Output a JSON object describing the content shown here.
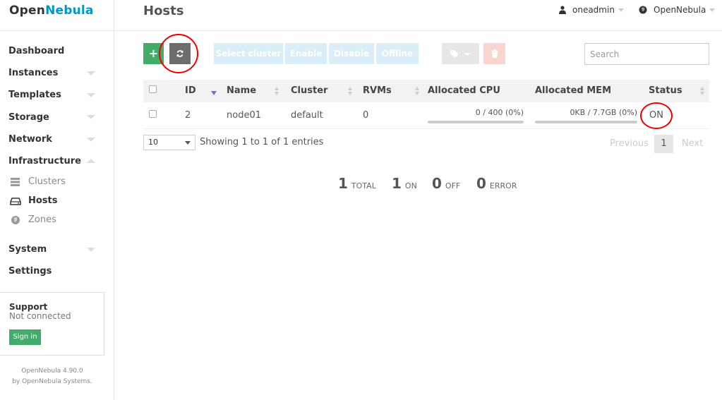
{
  "sidebar": {
    "logo_part1": "Open",
    "logo_part2": "Nebula",
    "items": {
      "dashboard": "Dashboard",
      "instances": "Instances",
      "templates": "Templates",
      "storage": "Storage",
      "network": "Network",
      "infrastructure": "Infrastructure",
      "system": "System",
      "settings": "Settings"
    },
    "sub_items": {
      "clusters": "Clusters",
      "hosts": "Hosts",
      "zones": "Zones"
    },
    "support": {
      "title": "Support",
      "status": "Not connected",
      "signin": "Sign in"
    },
    "version_line1": "OpenNebula 4.90.0",
    "version_line2": "by OpenNebula Systems."
  },
  "header": {
    "title": "Hosts",
    "user": "oneadmin",
    "zone": "OpenNebula"
  },
  "toolbar": {
    "add": "+",
    "select_cluster": "Select cluster",
    "enable": "Enable",
    "disable": "Disable",
    "offline": "Offline",
    "search_placeholder": "Search"
  },
  "table": {
    "columns": [
      "ID",
      "Name",
      "Cluster",
      "RVMs",
      "Allocated CPU",
      "Allocated MEM",
      "Status"
    ],
    "rows": [
      {
        "id": "2",
        "name": "node01",
        "cluster": "default",
        "rvms": "0",
        "cpu": "0 / 400 (0%)",
        "cpu_fraction": 0,
        "mem": "0KB / 7.7GB (0%)",
        "mem_fraction": 0,
        "status": "ON"
      }
    ]
  },
  "pagination": {
    "page_size": "10",
    "entries_text": "Showing 1 to 1 of 1 entries",
    "previous": "Previous",
    "current": "1",
    "next": "Next"
  },
  "summary": {
    "total_n": "1",
    "total_label": "TOTAL",
    "on_n": "1",
    "on_label": "ON",
    "off_n": "0",
    "off_label": "OFF",
    "error_n": "0",
    "error_label": "ERROR"
  },
  "colors": {
    "brand": "#0098c3",
    "success": "#43ac6a",
    "highlight_circle": "#e00000"
  }
}
